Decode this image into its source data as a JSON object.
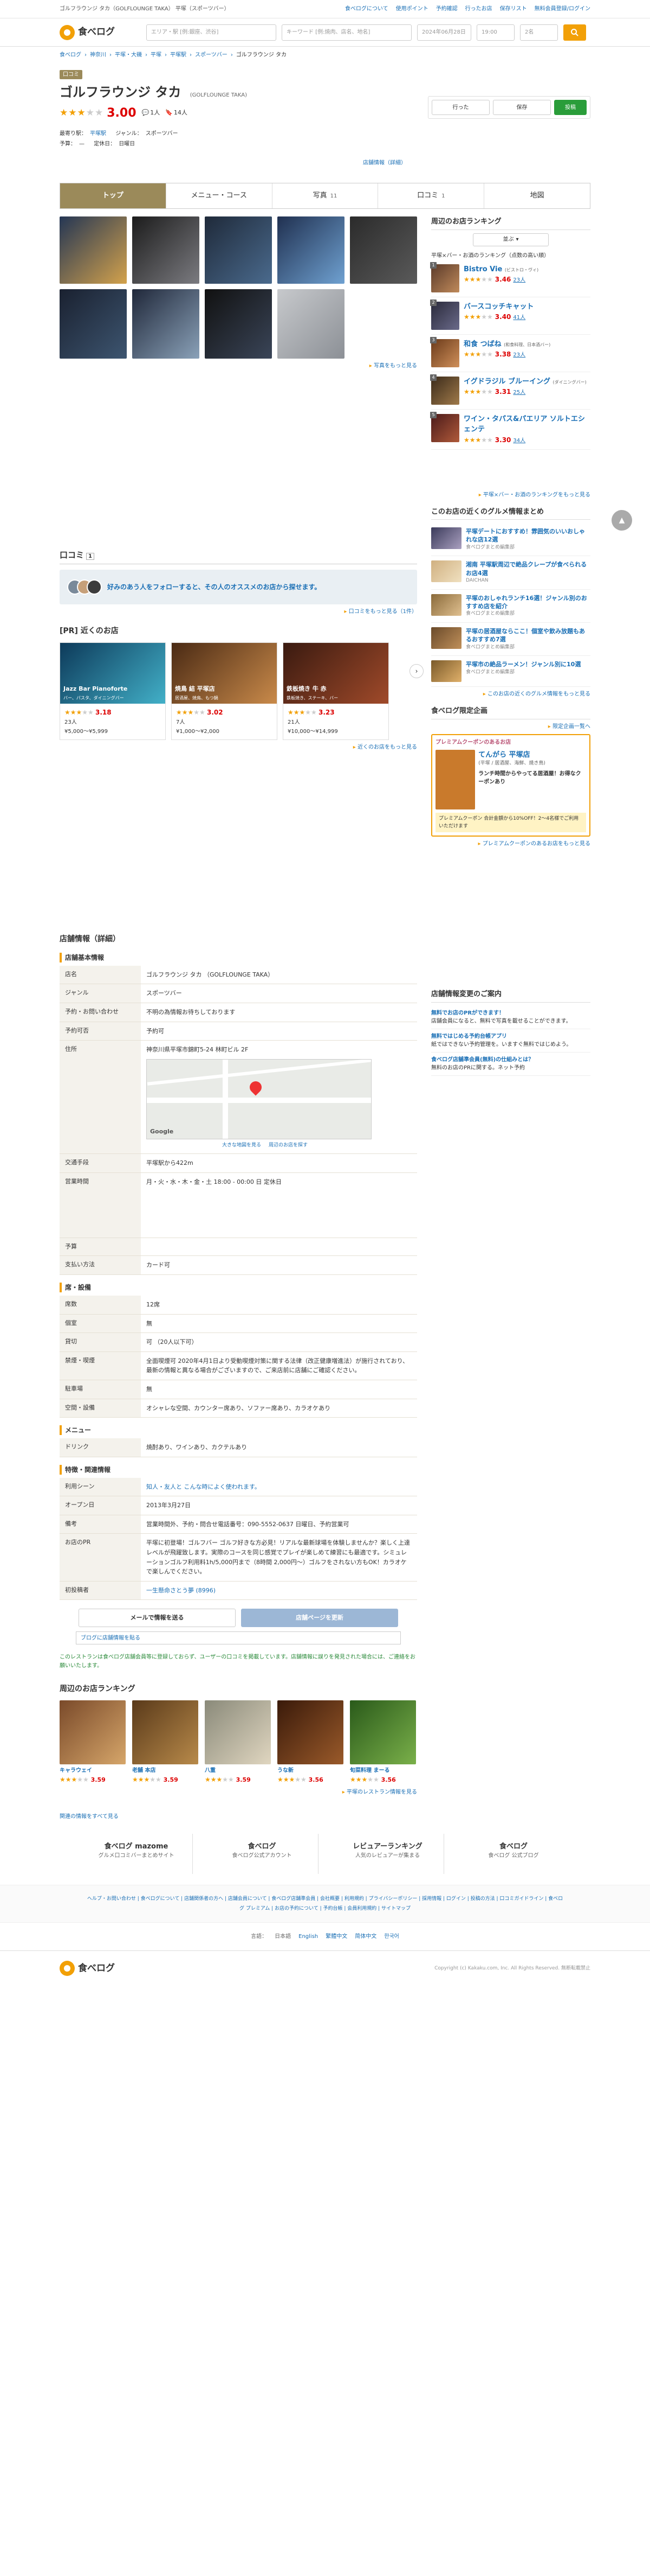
{
  "topbar": {
    "desc": "ゴルフラウンジ タカ（GOLFLOUNGE TAKA） 平塚（スポーツバー）",
    "links": [
      "食べログについて",
      "使用ポイント",
      "予約確認",
      "行ったお店",
      "保存リスト",
      "無料会員登録/ログイン"
    ]
  },
  "header": {
    "logo": "食べログ",
    "area_placeholder": "エリア・駅 [例:銀座、渋谷]",
    "keyword_placeholder": "キーワード [例:焼肉、店名、地名]",
    "date": "2024年06月28日",
    "time": "19:00",
    "people": "2名"
  },
  "breadcrumb": [
    "食べログ",
    "神奈川",
    "平塚・大磯",
    "平塚",
    "平塚駅",
    "スポーツバー",
    "ゴルフラウンジ タカ"
  ],
  "store": {
    "tag": "口コミ",
    "name": "ゴルフラウンジ タカ",
    "name_en": "(GOLFLOUNGE TAKA)",
    "score": "3.00",
    "reviews": "1人",
    "saves": "14人",
    "nearest_label": "最寄り駅：",
    "nearest": "平塚駅",
    "genre_label": "ジャンル：",
    "genre": "スポーツバー",
    "budget_label": "予算：",
    "holiday_label": "定休日：",
    "holiday": "日曜日",
    "detail_link": "店舗情報（詳細）"
  },
  "actions": {
    "went": "行った",
    "save": "保存",
    "share": "投稿"
  },
  "tabs": [
    {
      "label": "トップ",
      "n": ""
    },
    {
      "label": "メニュー・コース",
      "n": ""
    },
    {
      "label": "写真",
      "n": "11"
    },
    {
      "label": "口コミ",
      "n": "1"
    },
    {
      "label": "地図",
      "n": ""
    }
  ],
  "photos_more": "写真をもっと見る",
  "ranking": {
    "title": "周辺のお店ランキング",
    "sort": "並ぶ",
    "subtitle": "平塚×バー・お酒のランキング（点数の高い順）",
    "items": [
      {
        "no": "1",
        "name": "Bistro Vie",
        "sub": "(ビストロ・ヴィ)",
        "score": "3.46",
        "reviews": "23人"
      },
      {
        "no": "2",
        "name": "バースコッチキャット",
        "sub": "",
        "score": "3.40",
        "reviews": "41人"
      },
      {
        "no": "3",
        "name": "和食 つばね",
        "sub": "(和食料理、日本酒バー)",
        "score": "3.38",
        "reviews": "23人"
      },
      {
        "no": "4",
        "name": "イグドラジル ブルーイング",
        "sub": "(ダイニングバー)",
        "score": "3.31",
        "reviews": "25人"
      },
      {
        "no": "5",
        "name": "ワイン・タパス&パエリア ソルトエシェンテ",
        "sub": "",
        "score": "3.30",
        "reviews": "34人"
      }
    ],
    "more": "平塚×バー・お酒のランキングをもっと見る"
  },
  "reviews_section": {
    "title": "口コミ",
    "count": "1",
    "follow_text": "好みのあう人をフォローすると、その人のオススメのお店から探せます。",
    "more": "口コミをもっと見る（1件）"
  },
  "pr": {
    "title": "[PR] 近くのお店",
    "items": [
      {
        "name": "Jazz Bar Pianoforte",
        "cat": "バー、パスタ、ダイニングバー",
        "score": "3.18",
        "rev": "23人",
        "price": "¥5,000～¥5,999"
      },
      {
        "name": "焼鳥 結 平塚店",
        "cat": "居酒屋、焼鳥、もつ鍋",
        "score": "3.02",
        "rev": "7人",
        "price": "¥1,000～¥2,000"
      },
      {
        "name": "鉄板焼き 牛 赤",
        "cat": "鉄板焼き、ステーキ、バー",
        "score": "3.23",
        "rev": "21人",
        "price": "¥10,000～¥14,999"
      }
    ],
    "more": "近くのお店をもっと見る"
  },
  "articles": {
    "title": "このお店の近くのグルメ情報まとめ",
    "items": [
      {
        "t": "平塚デートにおすすめ！雰囲気のいいおしゃれな店12選",
        "s": "食べログまとめ編集部"
      },
      {
        "t": "湘南 平塚駅周辺で絶品クレープが食べられるお店4選",
        "s": "DAICHAN"
      },
      {
        "t": "平塚のおしゃれランチ16選！ジャンル別のおすすめ店を紹介",
        "s": "食べログまとめ編集部"
      },
      {
        "t": "平塚の居酒屋ならここ！個室や飲み放題もあるおすすめ7選",
        "s": "食べログまとめ編集部"
      },
      {
        "t": "平塚市の絶品ラーメン！ジャンル別に10選",
        "s": "食べログまとめ編集部"
      }
    ],
    "more": "このお店の近くのグルメ情報をもっと見る"
  },
  "limited": {
    "title": "食べログ限定企画",
    "more": "限定企画一覧へ",
    "coupon_top": "プレミアムクーポンのあるお店",
    "coupon_name": "てんがら 平塚店",
    "coupon_cat": "(平塚 / 居酒屋、海鮮、焼き鳥)",
    "coupon_desc": "ランチ時間からやってる居酒屋！お得なクーポンあり",
    "coupon_yellow": "プレミアムクーポン 合計金額から10%OFF！2〜4名様でご利用いただけます",
    "coupon_more": "プレミアムクーポンのあるお店をもっと見る"
  },
  "info": {
    "title": "店舗情報（詳細）",
    "basic": "店舗基本情報",
    "rows": [
      {
        "k": "店名",
        "v": "ゴルフラウンジ タカ （GOLFLOUNGE TAKA）"
      },
      {
        "k": "ジャンル",
        "v": "スポーツバー"
      },
      {
        "k": "予約・お問い合わせ",
        "v": "不明の為情報お待ちしております"
      },
      {
        "k": "予約可否",
        "v": "予約可"
      },
      {
        "k": "住所",
        "v": "神奈川県平塚市錦町5-24 林町ビル 2F"
      },
      {
        "k": "交通手段",
        "v": "平塚駅から422m"
      },
      {
        "k": "営業時間",
        "v": "月・火・水・木・金・土 18:00 - 00:00 日 定休日"
      },
      {
        "k": "予算",
        "v": ""
      },
      {
        "k": "支払い方法",
        "v": "カード可"
      }
    ],
    "map_link1": "大きな地図を見る",
    "map_link2": "周辺のお店を探す",
    "seat_title": "席・設備",
    "seats": [
      {
        "k": "席数",
        "v": "12席"
      },
      {
        "k": "個室",
        "v": "無"
      },
      {
        "k": "貸切",
        "v": "可 （20人以下可）"
      },
      {
        "k": "禁煙・喫煙",
        "v": "全面喫煙可 2020年4月1日より受動喫煙対策に関する法律（改正健康増進法）が施行されており、最新の情報と異なる場合がございますので、ご来店前に店舗にご確認ください。"
      },
      {
        "k": "駐車場",
        "v": "無"
      },
      {
        "k": "空間・設備",
        "v": "オシャレな空間、カウンター席あり、ソファー席あり、カラオケあり"
      }
    ],
    "menu_title": "メニュー",
    "menu": [
      {
        "k": "ドリンク",
        "v": "焼酎あり、ワインあり、カクテルあり"
      }
    ],
    "feature_title": "特徴・関連情報",
    "features": [
      {
        "k": "利用シーン",
        "v": "知人・友人と こんな時によく使われます。"
      },
      {
        "k": "オープン日",
        "v": "2013年3月27日"
      },
      {
        "k": "備考",
        "v": "営業時間外、予約・問合せ電話番号：090-5552-0637 日曜日、予約営業可"
      },
      {
        "k": "お店のPR",
        "v": "平塚に初登場！ゴルフバー ゴルフ好きな方必見！リアルな最新球場を体験しませんか？楽しく上達レベルが飛躍致します。実際のコースを同じ感覚でプレイが楽しめて練習にも最適です。シミュレーションゴルフ利用料1h/5,000円まで（8時間 2,000円～）ゴルフをされない方もOK！カラオケで楽しんでください。"
      },
      {
        "k": "初投稿者",
        "v": "一生懸命さとう夢 (8996)"
      }
    ]
  },
  "update": {
    "title": "店舗情報変更のご案内",
    "rows": [
      {
        "t": "無料でお店のPRができます！",
        "s": "店舗会員になると、無料で写真を載せることができます。"
      },
      {
        "t": "無料ではじめる予約台帳アプリ",
        "s": "紙ではできない予約管理を。いますぐ無料ではじめよう。"
      },
      {
        "t": "食べログ店舗準会員(無料)の仕組みとは？",
        "s": "無料のお店のPRに関する。ネット予約"
      }
    ]
  },
  "cta": {
    "mail": "メールで情報を送る",
    "edit": "店舗ページを更新",
    "blog": "ブログに店舗情報を貼る"
  },
  "notice": "このレストランは食べログ店舗会員等に登録しておらず、ユーザーの口コミを掲載しています。店舗情報に誤りを発見された場合には、ご連絡をお願いいたします。",
  "nearby": {
    "title": "周辺のお店ランキング",
    "items": [
      {
        "name": "キャラウェイ",
        "score": "3.59"
      },
      {
        "name": "老舗 本店",
        "score": "3.59"
      },
      {
        "name": "八重",
        "score": "3.59"
      },
      {
        "name": "うな新",
        "score": "3.56"
      },
      {
        "name": "旬菜料理 まーる",
        "score": "3.56"
      }
    ],
    "more": "平塚のレストラン情報を見る"
  },
  "all_link": "関連の情報をすべて見る",
  "footer_banners": [
    {
      "b": "食べログ mazome",
      "s": "グルメ口コミバーまとめサイト"
    },
    {
      "b": "食べログ",
      "s": "食べログ公式アカウント"
    },
    {
      "b": "レビュアーランキング",
      "s": "人気のレビュアーが集まる"
    },
    {
      "b": "食べログ",
      "s": "食べログ 公式ブログ"
    }
  ],
  "footer_links": "ヘルプ・お問い合わせ | 食べログについて | 店舗関係者の方へ | 店舗会員について | 食べログ店舗準会員 | 会社概要 | 利用規約 | プライバシーポリシー | 採用情報 | ログイン | 投稿の方法 | 口コミガイドライン | 食べログ プレミアム | お店の予約について | 予約台帳 | 会員利用規約 | サイトマップ",
  "languages": [
    "日本語",
    "English",
    "繁體中文",
    "简体中文",
    "한국어"
  ],
  "lang_label": "言語：",
  "copyright": "Copyright (c) Kakaku.com, Inc. All Rights Reserved. 無断転載禁止",
  "colors": {
    "accent": "#f2a007",
    "brand_tab": "#9b8a5a",
    "score": "#d00",
    "link": "#1a6fb5"
  }
}
